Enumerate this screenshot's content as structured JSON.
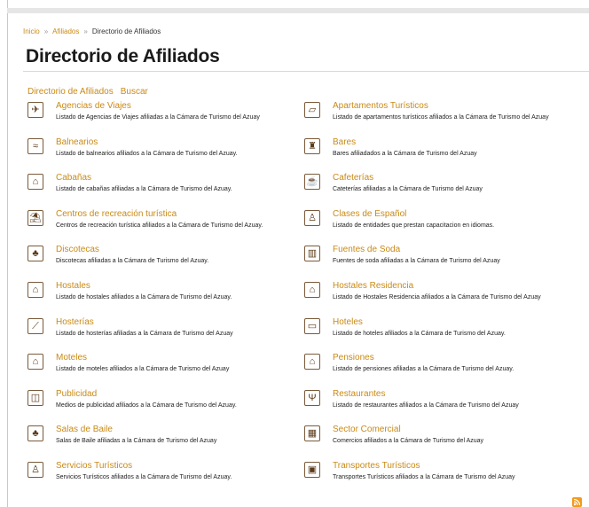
{
  "breadcrumb": {
    "home": "Inicio",
    "section": "Afiliados",
    "current": "Directorio de Afiliados",
    "separator": "»"
  },
  "page_title": "Directorio de Afiliados",
  "subnav": {
    "directory": "Directorio de Afiliados",
    "search": "Buscar"
  },
  "categories": [
    {
      "name": "Agencias de Viajes",
      "desc": "Listado de Agencias de Viajes afiliadas a la Cámara de Turismo del Azuay",
      "icon": "airplane-icon"
    },
    {
      "name": "Apartamentos Turísticos",
      "desc": "Listado de apartamentos turísticos afiliados a la Cámara de Turismo del Azuay",
      "icon": "building-icon"
    },
    {
      "name": "Balnearios",
      "desc": "Listado de balnearios afiliados a la Cámara de Turismo del Azuay.",
      "icon": "swimmer-icon"
    },
    {
      "name": "Bares",
      "desc": "Bares afiliadados a la Cámara de Turismo del Azuay",
      "icon": "bottle-glass-icon"
    },
    {
      "name": "Cabañas",
      "desc": "Listado de cabañas afiliadas a la Cámara de Turismo del Azuay.",
      "icon": "cabin-icon"
    },
    {
      "name": "Cafeterías",
      "desc": "Cateterías afiliadas a la Cámara de Turismo del Azuay",
      "icon": "coffee-cup-icon"
    },
    {
      "name": "Centros de recreación turística",
      "desc": "Centros de recreación turística afiliados a la Cámara de Turismo del Azuay.",
      "icon": "recreation-icon"
    },
    {
      "name": "Clases de Español",
      "desc": "Listado de entidades que prestan capacitacion en idiomas.",
      "icon": "teacher-icon"
    },
    {
      "name": "Discotecas",
      "desc": "Discotecas afiliadas a la Cámara de Turismo del Azuay.",
      "icon": "dancers-icon"
    },
    {
      "name": "Fuentes de Soda",
      "desc": "Fuentes de soda afiliadas a la Cámara de Turismo del Azuay",
      "icon": "soda-icon"
    },
    {
      "name": "Hostales",
      "desc": "Listado de hostales afiliados a la Cámara de Turismo del Azuay.",
      "icon": "hostel-icon"
    },
    {
      "name": "Hostales Residencia",
      "desc": "Listado de Hostales Residencia afiliados a la Cámara de Turismo del Azuay",
      "icon": "hostel-residence-icon"
    },
    {
      "name": "Hosterías",
      "desc": "Listado de hosterías afiliadas a la Cámara de Turismo del Azuay",
      "icon": "inn-icon"
    },
    {
      "name": "Hoteles",
      "desc": "Listado de hoteles afiliados a la Cámara de Turismo del Azuay.",
      "icon": "bed-icon"
    },
    {
      "name": "Moteles",
      "desc": "Listado de moteles afiliados a la Cámara de Turismo del Azuay",
      "icon": "motel-icon"
    },
    {
      "name": "Pensiones",
      "desc": "Listado de pensiones afiliadas a la Cámara de Turismo del Azuay.",
      "icon": "guesthouse-icon"
    },
    {
      "name": "Publicidad",
      "desc": "Medios de publicidad afiliados a la Cámara de Turismo del Azuay.",
      "icon": "radio-icon"
    },
    {
      "name": "Restaurantes",
      "desc": "Listado de restaurantes afiliados a la Cámara de Turismo del Azuay",
      "icon": "cutlery-icon"
    },
    {
      "name": "Salas de Baile",
      "desc": "Salas de Baile afiliadas a la Cámara de Turismo del Azuay",
      "icon": "dancers-icon"
    },
    {
      "name": "Sector Comercial",
      "desc": "Comercios afiliados a la Cámara de Turismo del Azuay",
      "icon": "shop-icon"
    },
    {
      "name": "Servicios Turísticos",
      "desc": "Servicios Turísticos afiliados a la Cámara de Turismo del Azuay.",
      "icon": "person-icon"
    },
    {
      "name": "Transportes Turísticos",
      "desc": "Transportes Turísticos afiliados a la Cámara de Turismo del Azuay",
      "icon": "bus-icon"
    }
  ],
  "icon_glyphs": {
    "airplane-icon": "✈",
    "building-icon": "▱",
    "swimmer-icon": "≈",
    "bottle-glass-icon": "♜",
    "cabin-icon": "⌂",
    "coffee-cup-icon": "☕",
    "recreation-icon": "⛱",
    "teacher-icon": "♙",
    "dancers-icon": "♣",
    "soda-icon": "▥",
    "hostel-icon": "⌂",
    "hostel-residence-icon": "⌂",
    "inn-icon": "⟋",
    "bed-icon": "▭",
    "motel-icon": "⌂",
    "guesthouse-icon": "⌂",
    "radio-icon": "◫",
    "cutlery-icon": "Ψ",
    "shop-icon": "▦",
    "person-icon": "♙",
    "bus-icon": "▣"
  },
  "colors": {
    "link": "#c98a17",
    "icon_border": "#7a5a3a",
    "rss": "#f29a1d"
  },
  "rss_icon": "rss-feed-icon"
}
